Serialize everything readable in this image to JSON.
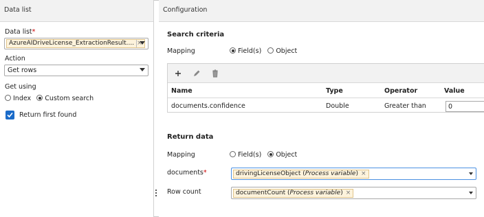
{
  "left": {
    "header": "Data list",
    "data_list_label": "Data list",
    "data_list_value": "AzureAIDriveLicense_ExtractionResult....",
    "action_label": "Action",
    "action_value": "Get rows",
    "get_using_label": "Get using",
    "get_using_options": [
      "Index",
      "Custom search"
    ],
    "get_using_selected": "Custom search",
    "return_first_label": "Return first found",
    "return_first_checked": true
  },
  "right": {
    "header": "Configuration",
    "search": {
      "title": "Search criteria",
      "mapping_label": "Mapping",
      "mapping_options": [
        "Field(s)",
        "Object"
      ],
      "mapping_selected": "Field(s)",
      "columns": [
        "Name",
        "Type",
        "Operator",
        "Value"
      ],
      "rows": [
        {
          "name": "documents.confidence",
          "type": "Double",
          "operator": "Greater than",
          "value": "0"
        }
      ]
    },
    "return": {
      "title": "Return data",
      "mapping_label": "Mapping",
      "mapping_options": [
        "Field(s)",
        "Object"
      ],
      "mapping_selected": "Object",
      "documents_label": "documents",
      "documents_chip": "drivingLicenseObject",
      "documents_chip_type": "Process variable",
      "rowcount_label": "Row count",
      "rowcount_chip": "documentCount",
      "rowcount_chip_type": "Process variable"
    }
  },
  "colors": {
    "accent": "#1a6bc9",
    "chip_bg": "#fdf3dc",
    "required": "#cc0000"
  }
}
